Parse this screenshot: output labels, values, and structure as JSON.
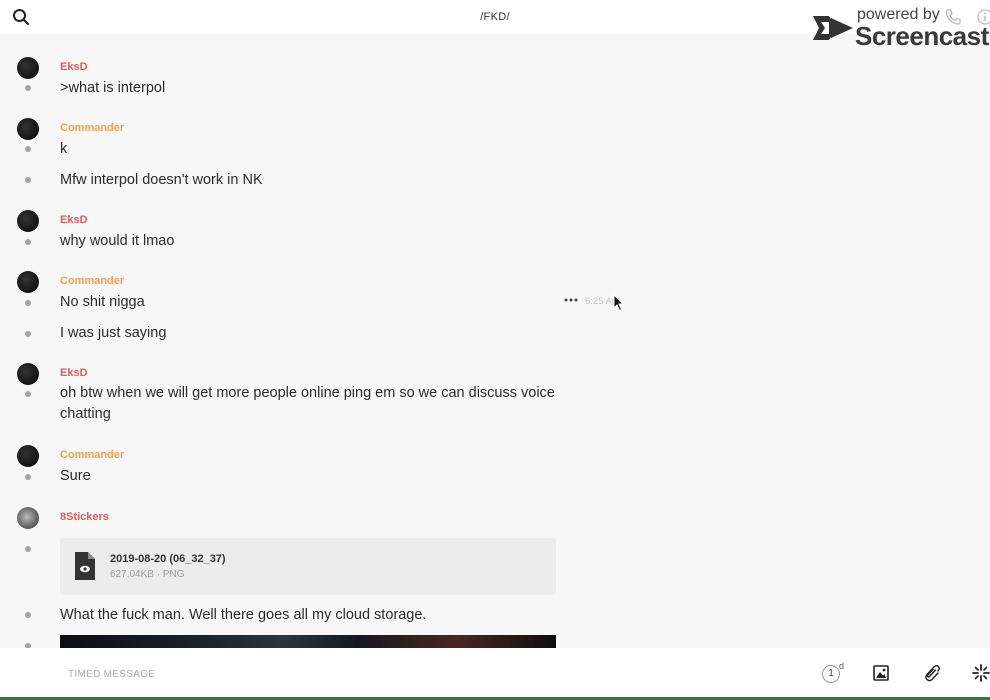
{
  "header": {
    "channel_title": "/FKD/",
    "icons": [
      "search-icon",
      "phone-icon",
      "info-icon"
    ]
  },
  "watermark": {
    "line1": "powered by",
    "line2": "Screencastify"
  },
  "messages": [
    {
      "author": "EksD",
      "author_color": "#e05a5a",
      "lines": [
        ">what is interpol"
      ]
    },
    {
      "author": "Commander",
      "author_color": "#f0a04a",
      "lines": [
        "k",
        "Mfw interpol doesn't work in NK"
      ]
    },
    {
      "author": "EksD",
      "author_color": "#e05a5a",
      "lines": [
        "why would it lmao"
      ]
    },
    {
      "author": "Commander",
      "author_color": "#f0a04a",
      "lines": [
        "No shit nigga",
        "I was just saying"
      ]
    },
    {
      "author": "EksD",
      "author_color": "#e05a5a",
      "lines": [
        "oh btw when we will get more people online ping em so we can discuss voice chatting"
      ]
    },
    {
      "author": "Commander",
      "author_color": "#f0a04a",
      "lines": [
        "Sure"
      ]
    },
    {
      "author": "8Stickers",
      "author_color": "#e05a5a",
      "lines": [
        "What the fuck man. Well there goes all my cloud storage."
      ]
    }
  ],
  "hover": {
    "timestamp": "5:25 AM"
  },
  "attachment": {
    "name": "2019-08-20 (06_32_37)",
    "meta": "627.04KB · PNG"
  },
  "composer": {
    "placeholder": "TIMED MESSAGE",
    "timer_value": "1",
    "timer_unit": "d"
  }
}
